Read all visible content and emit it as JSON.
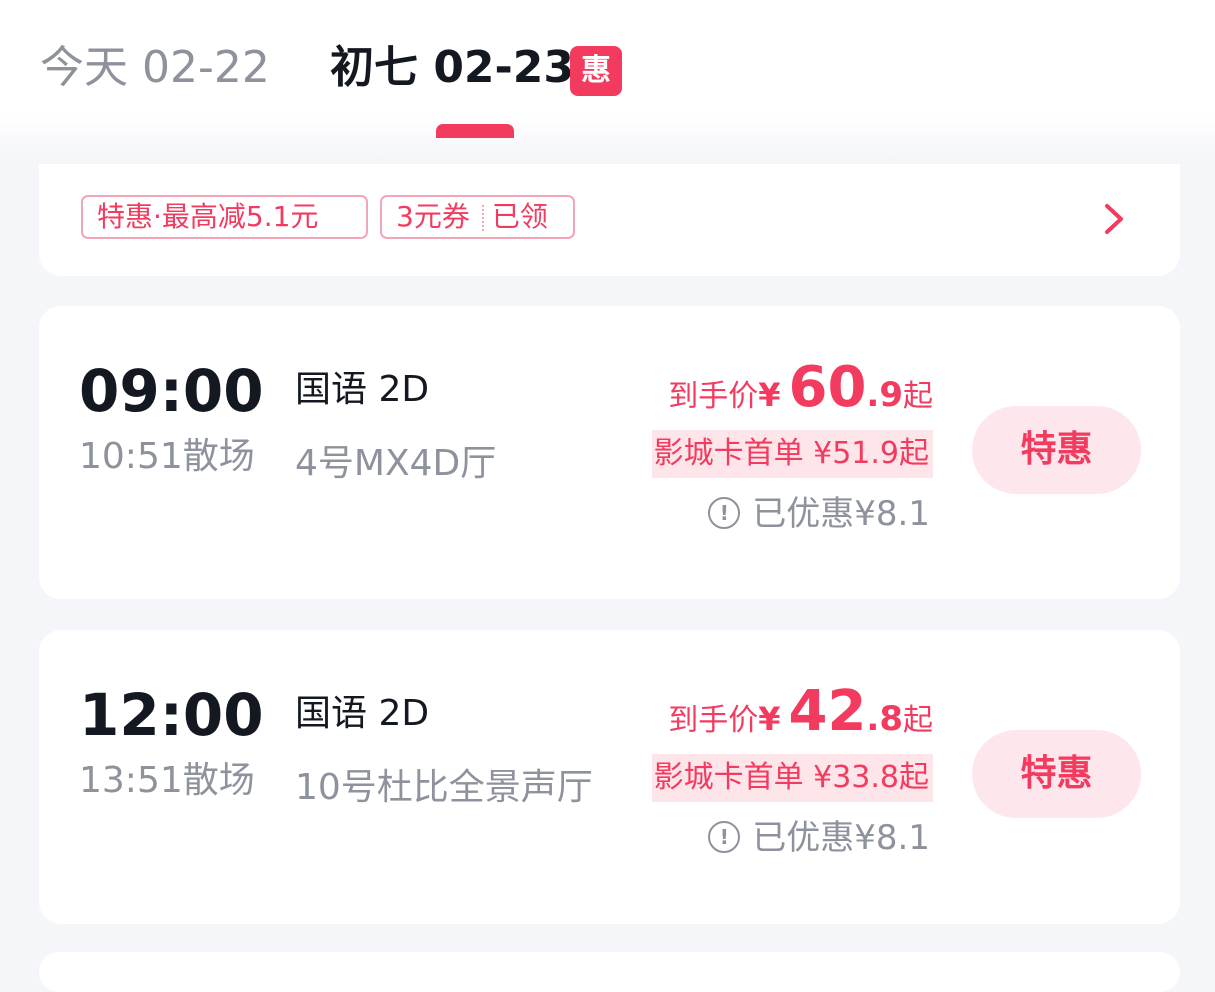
{
  "date_tabs": [
    {
      "label": "今天 02-22",
      "active": false
    },
    {
      "label": "初七 02-23",
      "active": true,
      "badge": "惠"
    }
  ],
  "promo": {
    "tag1": "特惠·最高减5.1元",
    "tag2_left": "3元券",
    "tag2_right": "已领"
  },
  "showtimes": [
    {
      "start": "09:00",
      "end": "10:51散场",
      "language": "国语 2D",
      "hall": "4号MX4D厅",
      "price_label": "到手价",
      "yen": "¥",
      "price_int": "60",
      "price_dec": ".9",
      "price_suffix": "起",
      "card_price": "影城卡首单 ¥51.9起",
      "discount": "已优惠¥8.1",
      "button": "特惠"
    },
    {
      "start": "12:00",
      "end": "13:51散场",
      "language": "国语 2D",
      "hall": "10号杜比全景声厅",
      "price_label": "到手价",
      "yen": "¥",
      "price_int": "42",
      "price_dec": ".8",
      "price_suffix": "起",
      "card_price": "影城卡首单 ¥33.8起",
      "discount": "已优惠¥8.1",
      "button": "特惠"
    }
  ],
  "colors": {
    "accent": "#f23b5f",
    "muted": "#8d929c",
    "background": "#f5f6fa"
  },
  "icons": {
    "chevron": "chevron-right-icon",
    "info": "info-circle-icon"
  }
}
